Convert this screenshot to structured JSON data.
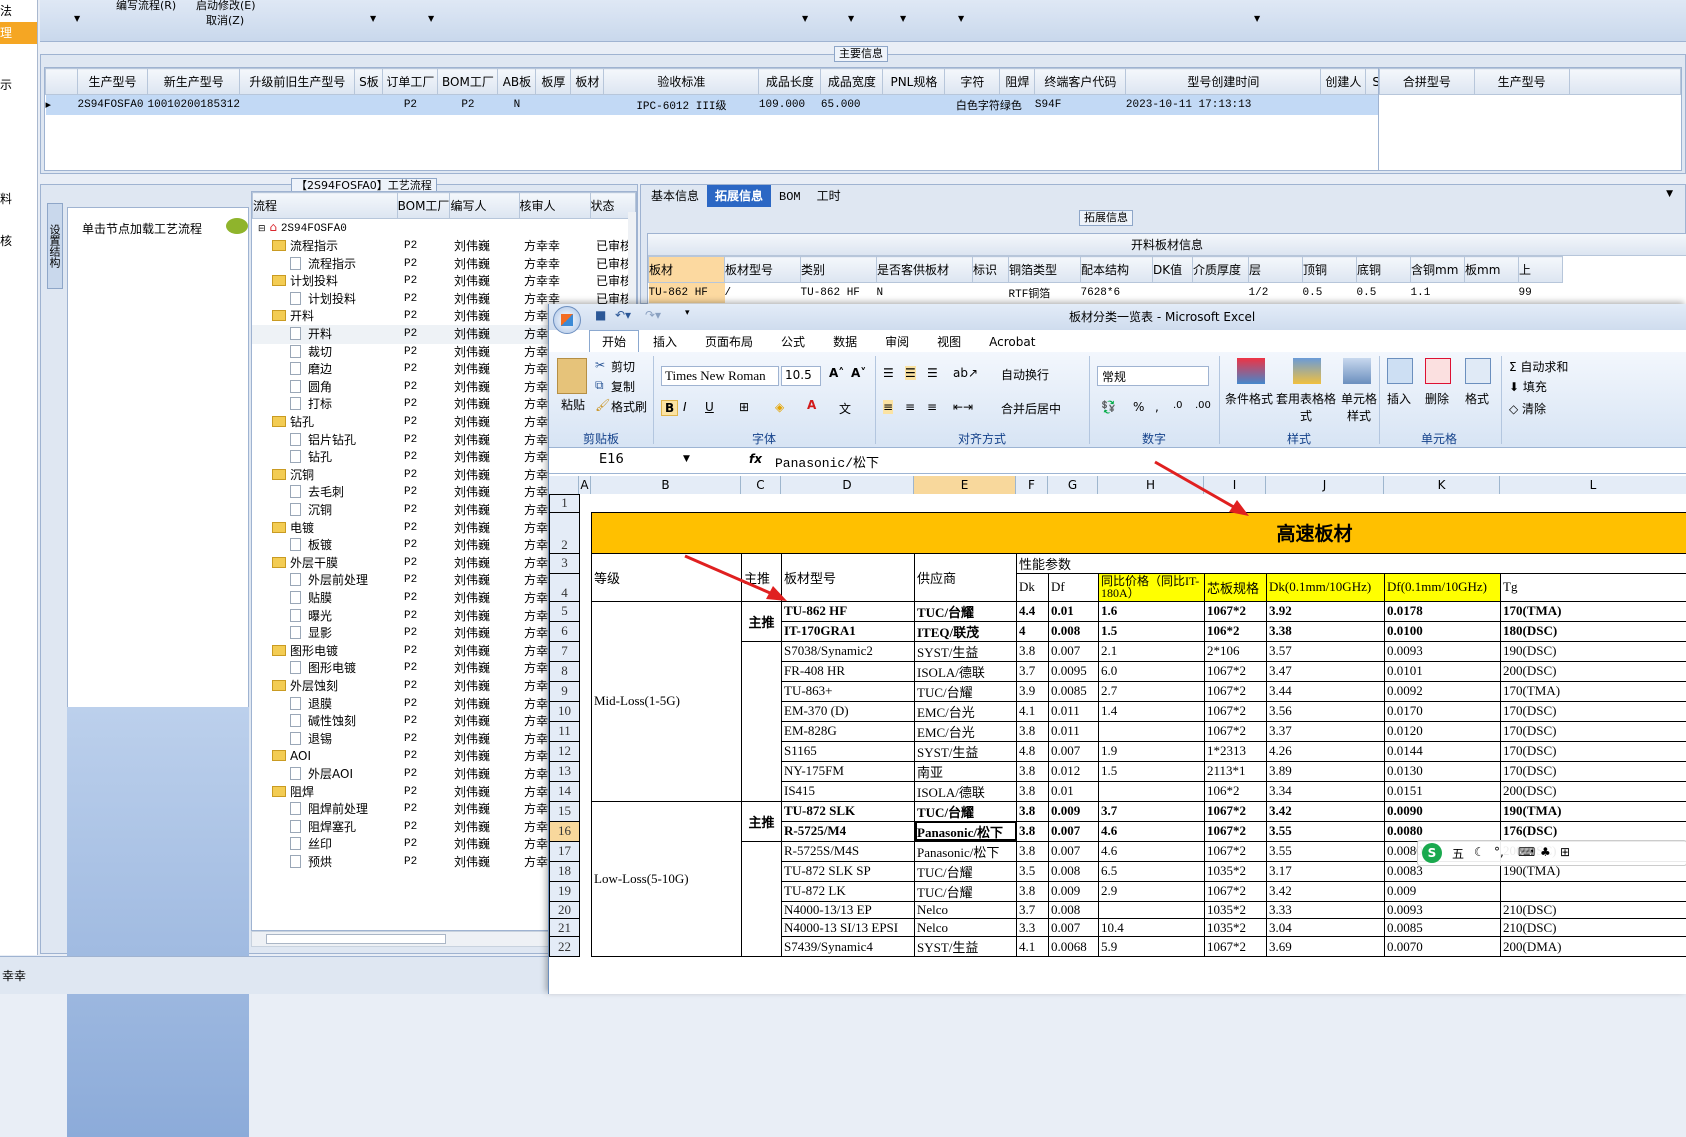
{
  "left_nav": [
    "法",
    "理",
    "示",
    "",
    "料",
    "核"
  ],
  "top_menu": {
    "edit_flow": "编写流程(R)",
    "start_modify": "启动修改(E)",
    "cancel": "取消(Z)"
  },
  "main_info": {
    "title": "主要信息",
    "columns": [
      "生产型号",
      "新生产型号",
      "升级前旧生产型号",
      "S板",
      "订单工厂",
      "BOM工厂",
      "AB板",
      "板厚",
      "板材",
      "验收标准",
      "成品长度",
      "成品宽度",
      "PNL规格",
      "字符",
      "阻焊",
      "终端客户代码",
      "型号创建时间",
      "创建人",
      "SO"
    ],
    "row": [
      "2S94FOSFA0",
      "10010200185312",
      "",
      "",
      "P2",
      "P2",
      "N",
      "",
      "",
      "IPC-6012 III级",
      "109.000",
      "65.000",
      "",
      "白色字符",
      "绿色",
      "S94F",
      "2023-10-11 17:13:13",
      "",
      ""
    ],
    "side_columns": [
      "合拼型号",
      "生产型号"
    ]
  },
  "process": {
    "title": "【2S94FOSFA0】工艺流程",
    "side_tab": "设置结构",
    "hint": "单击节点加载工艺流程",
    "columns": [
      "流程",
      "BOM工厂",
      "编写人",
      "核审人",
      "状态"
    ],
    "root": "2S94FOSFA0",
    "rows": [
      {
        "name": "流程指示",
        "type": "folder",
        "bom": "P2",
        "writer": "刘伟巍",
        "reviewer": "方幸幸",
        "status": "已审核"
      },
      {
        "name": "流程指示",
        "type": "doc",
        "bom": "P2",
        "writer": "刘伟巍",
        "reviewer": "方幸幸",
        "status": "已审核"
      },
      {
        "name": "计划投料",
        "type": "folder",
        "bom": "P2",
        "writer": "刘伟巍",
        "reviewer": "方幸幸",
        "status": "已审核"
      },
      {
        "name": "计划投料",
        "type": "doc",
        "bom": "P2",
        "writer": "刘伟巍",
        "reviewer": "方幸幸",
        "status": "已审核"
      },
      {
        "name": "开料",
        "type": "folder",
        "bom": "P2",
        "writer": "刘伟巍",
        "reviewer": "方幸幸",
        "status": ""
      },
      {
        "name": "开料",
        "type": "doc",
        "bom": "P2",
        "writer": "刘伟巍",
        "reviewer": "方幸",
        "status": ""
      },
      {
        "name": "裁切",
        "type": "doc",
        "bom": "P2",
        "writer": "刘伟巍",
        "reviewer": "方幸",
        "status": ""
      },
      {
        "name": "磨边",
        "type": "doc",
        "bom": "P2",
        "writer": "刘伟巍",
        "reviewer": "方幸",
        "status": ""
      },
      {
        "name": "圆角",
        "type": "doc",
        "bom": "P2",
        "writer": "刘伟巍",
        "reviewer": "方幸",
        "status": ""
      },
      {
        "name": "打标",
        "type": "doc",
        "bom": "P2",
        "writer": "刘伟巍",
        "reviewer": "方幸",
        "status": ""
      },
      {
        "name": "钻孔",
        "type": "folder",
        "bom": "P2",
        "writer": "刘伟巍",
        "reviewer": "方幸",
        "status": ""
      },
      {
        "name": "铝片钻孔",
        "type": "doc",
        "bom": "P2",
        "writer": "刘伟巍",
        "reviewer": "方幸",
        "status": ""
      },
      {
        "name": "钻孔",
        "type": "doc",
        "bom": "P2",
        "writer": "刘伟巍",
        "reviewer": "方幸",
        "status": ""
      },
      {
        "name": "沉铜",
        "type": "folder",
        "bom": "P2",
        "writer": "刘伟巍",
        "reviewer": "方幸",
        "status": ""
      },
      {
        "name": "去毛刺",
        "type": "doc",
        "bom": "P2",
        "writer": "刘伟巍",
        "reviewer": "方幸",
        "status": ""
      },
      {
        "name": "沉铜",
        "type": "doc",
        "bom": "P2",
        "writer": "刘伟巍",
        "reviewer": "方幸",
        "status": ""
      },
      {
        "name": "电镀",
        "type": "folder",
        "bom": "P2",
        "writer": "刘伟巍",
        "reviewer": "方幸",
        "status": ""
      },
      {
        "name": "板镀",
        "type": "doc",
        "bom": "P2",
        "writer": "刘伟巍",
        "reviewer": "方幸",
        "status": ""
      },
      {
        "name": "外层干膜",
        "type": "folder",
        "bom": "P2",
        "writer": "刘伟巍",
        "reviewer": "方幸",
        "status": ""
      },
      {
        "name": "外层前处理",
        "type": "doc",
        "bom": "P2",
        "writer": "刘伟巍",
        "reviewer": "方幸",
        "status": ""
      },
      {
        "name": "贴膜",
        "type": "doc",
        "bom": "P2",
        "writer": "刘伟巍",
        "reviewer": "方幸",
        "status": ""
      },
      {
        "name": "曝光",
        "type": "doc",
        "bom": "P2",
        "writer": "刘伟巍",
        "reviewer": "方幸",
        "status": ""
      },
      {
        "name": "显影",
        "type": "doc",
        "bom": "P2",
        "writer": "刘伟巍",
        "reviewer": "方幸",
        "status": ""
      },
      {
        "name": "图形电镀",
        "type": "folder",
        "bom": "P2",
        "writer": "刘伟巍",
        "reviewer": "方幸",
        "status": ""
      },
      {
        "name": "图形电镀",
        "type": "doc",
        "bom": "P2",
        "writer": "刘伟巍",
        "reviewer": "方幸",
        "status": ""
      },
      {
        "name": "外层蚀刻",
        "type": "folder",
        "bom": "P2",
        "writer": "刘伟巍",
        "reviewer": "方幸",
        "status": ""
      },
      {
        "name": "退膜",
        "type": "doc",
        "bom": "P2",
        "writer": "刘伟巍",
        "reviewer": "方幸",
        "status": ""
      },
      {
        "name": "碱性蚀刻",
        "type": "doc",
        "bom": "P2",
        "writer": "刘伟巍",
        "reviewer": "方幸",
        "status": ""
      },
      {
        "name": "退锡",
        "type": "doc",
        "bom": "P2",
        "writer": "刘伟巍",
        "reviewer": "方幸",
        "status": ""
      },
      {
        "name": "AOI",
        "type": "folder",
        "bom": "P2",
        "writer": "刘伟巍",
        "reviewer": "方幸",
        "status": ""
      },
      {
        "name": "外层AOI",
        "type": "doc",
        "bom": "P2",
        "writer": "刘伟巍",
        "reviewer": "方幸",
        "status": ""
      },
      {
        "name": "阻焊",
        "type": "folder",
        "bom": "P2",
        "writer": "刘伟巍",
        "reviewer": "方幸",
        "status": ""
      },
      {
        "name": "阻焊前处理",
        "type": "doc",
        "bom": "P2",
        "writer": "刘伟巍",
        "reviewer": "方幸",
        "status": ""
      },
      {
        "name": "阻焊塞孔",
        "type": "doc",
        "bom": "P2",
        "writer": "刘伟巍",
        "reviewer": "方幸",
        "status": ""
      },
      {
        "name": "丝印",
        "type": "doc",
        "bom": "P2",
        "writer": "刘伟巍",
        "reviewer": "方幸",
        "status": ""
      },
      {
        "name": "预烘",
        "type": "doc",
        "bom": "P2",
        "writer": "刘伟巍",
        "reviewer": "方幸",
        "status": ""
      }
    ]
  },
  "detail_tabs": [
    "基本信息",
    "拓展信息",
    "BOM",
    "工时"
  ],
  "ext_info": {
    "title": "拓展信息",
    "table_title": "开料板材信息",
    "columns": [
      "板材",
      "板材型号",
      "类别",
      "是否客供板材",
      "标识",
      "铜箔类型",
      "配本结构",
      "DK值",
      "介质厚度",
      "层",
      "顶铜",
      "底铜",
      "含铜mm",
      "板mm",
      "上"
    ],
    "row": [
      "TU-862 HF",
      "/",
      "TU-862 HF",
      "N",
      "",
      "RTF铜箔",
      "7628*6",
      "",
      "",
      "1/2",
      "0.5",
      "0.5",
      "1.1",
      "",
      "99"
    ]
  },
  "status_bar": "幸幸",
  "excel": {
    "title": "板材分类一览表 - Microsoft Excel",
    "tabs": [
      "开始",
      "插入",
      "页面布局",
      "公式",
      "数据",
      "审阅",
      "视图",
      "Acrobat"
    ],
    "clipboard": {
      "paste": "粘贴",
      "cut": "剪切",
      "copy": "复制",
      "format_painter": "格式刷",
      "group": "剪贴板"
    },
    "font": {
      "name": "Times New Roman",
      "size": "10.5",
      "group": "字体"
    },
    "align": {
      "wrap": "自动换行",
      "merge": "合并后居中",
      "group": "对齐方式"
    },
    "number": {
      "format": "常规",
      "group": "数字"
    },
    "styles": {
      "conditional": "条件格式",
      "table": "套用表格格式",
      "cell": "单元格样式",
      "group": "样式"
    },
    "cells": {
      "insert": "插入",
      "delete": "删除",
      "format": "格式",
      "group": "单元格"
    },
    "editing": {
      "autosum": "自动求和",
      "fill": "填充",
      "clear": "清除"
    },
    "name_box": "E16",
    "formula": "Panasonic/松下",
    "columns": [
      "A",
      "B",
      "C",
      "D",
      "E",
      "F",
      "G",
      "H",
      "I",
      "J",
      "K",
      "L"
    ],
    "banner": "高速板材",
    "perf_params": "性能参数",
    "headers": {
      "grade": "等级",
      "main": "主推",
      "model": "板材型号",
      "supplier": "供应商",
      "dk": "Dk",
      "df": "Df",
      "price": "同比价格（同比IT-180A）",
      "core": "芯板规格",
      "dk10": "Dk(0.1mm/10GHz)",
      "df10": "Df(0.1mm/10GHz)",
      "tg": "Tg"
    },
    "grade_mid": "Mid-Loss(1-5G)",
    "grade_low": "Low-Loss(5-10G)",
    "main_label": "主推",
    "rows": [
      {
        "r": "5",
        "model": "TU-862 HF",
        "sup": "TUC/台耀",
        "dk": "4.4",
        "df": "0.01",
        "price": "1.6",
        "core": "1067*2",
        "dk10": "3.92",
        "df10": "0.0178",
        "tg": "170(TMA)",
        "bold": true
      },
      {
        "r": "6",
        "model": "IT-170GRA1",
        "sup": "ITEQ/联茂",
        "dk": "4",
        "df": "0.008",
        "price": "1.5",
        "core": "106*2",
        "dk10": "3.38",
        "df10": "0.0100",
        "tg": "180(DSC)",
        "bold": true
      },
      {
        "r": "7",
        "model": "S7038/Synamic2",
        "sup": "SYST/生益",
        "dk": "3.8",
        "df": "0.007",
        "price": "2.1",
        "core": "2*106",
        "dk10": "3.57",
        "df10": "0.0093",
        "tg": "190(DSC)",
        "bold": false
      },
      {
        "r": "8",
        "model": "FR-408 HR",
        "sup": "ISOLA/德联",
        "dk": "3.7",
        "df": "0.0095",
        "price": "6.0",
        "core": "1067*2",
        "dk10": "3.47",
        "df10": "0.0101",
        "tg": "200(DSC)",
        "bold": false
      },
      {
        "r": "9",
        "model": "TU-863+",
        "sup": "TUC/台耀",
        "dk": "3.9",
        "df": "0.0085",
        "price": "2.7",
        "core": "1067*2",
        "dk10": "3.44",
        "df10": "0.0092",
        "tg": "170(TMA)",
        "bold": false
      },
      {
        "r": "10",
        "model": "EM-370 (D)",
        "sup": "EMC/台光",
        "dk": "4.1",
        "df": "0.011",
        "price": "1.4",
        "core": "1067*2",
        "dk10": "3.56",
        "df10": "0.0170",
        "tg": "170(DSC)",
        "bold": false
      },
      {
        "r": "11",
        "model": "EM-828G",
        "sup": "EMC/台光",
        "dk": "3.8",
        "df": "0.011",
        "price": "",
        "core": "1067*2",
        "dk10": "3.37",
        "df10": "0.0120",
        "tg": "170(DSC)",
        "bold": false
      },
      {
        "r": "12",
        "model": "S1165",
        "sup": "SYST/生益",
        "dk": "4.8",
        "df": "0.007",
        "price": "1.9",
        "core": "1*2313",
        "dk10": "4.26",
        "df10": "0.0144",
        "tg": "170(DSC)",
        "bold": false
      },
      {
        "r": "13",
        "model": "NY-175FM",
        "sup": "南亚",
        "dk": "3.8",
        "df": "0.012",
        "price": "1.5",
        "core": "2113*1",
        "dk10": "3.89",
        "df10": "0.0130",
        "tg": "170(DSC)",
        "bold": false
      },
      {
        "r": "14",
        "model": "IS415",
        "sup": "ISOLA/德联",
        "dk": "3.8",
        "df": "0.01",
        "price": "",
        "core": "106*2",
        "dk10": "3.34",
        "df10": "0.0151",
        "tg": "200(DSC)",
        "bold": false
      },
      {
        "r": "15",
        "model": "TU-872 SLK",
        "sup": "TUC/台耀",
        "dk": "3.8",
        "df": "0.009",
        "price": "3.7",
        "core": "1067*2",
        "dk10": "3.42",
        "df10": "0.0090",
        "tg": "190(TMA)",
        "bold": true
      },
      {
        "r": "16",
        "model": "R-5725/M4",
        "sup": "Panasonic/松下",
        "dk": "3.8",
        "df": "0.007",
        "price": "4.6",
        "core": "1067*2",
        "dk10": "3.55",
        "df10": "0.0080",
        "tg": "176(DSC)",
        "bold": true
      },
      {
        "r": "17",
        "model": "R-5725S/M4S",
        "sup": "Panasonic/松下",
        "dk": "3.8",
        "df": "0.007",
        "price": "4.6",
        "core": "1067*2",
        "dk10": "3.55",
        "df10": "0.0080",
        "tg": "200(DSC)",
        "bold": false
      },
      {
        "r": "18",
        "model": "TU-872 SLK SP",
        "sup": "TUC/台耀",
        "dk": "3.5",
        "df": "0.008",
        "price": "6.5",
        "core": "1035*2",
        "dk10": "3.17",
        "df10": "0.0083",
        "tg": "190(TMA)",
        "bold": false
      },
      {
        "r": "19",
        "model": "TU-872 LK",
        "sup": "TUC/台耀",
        "dk": "3.8",
        "df": "0.009",
        "price": "2.9",
        "core": "1067*2",
        "dk10": "3.42",
        "df10": "0.009",
        "tg": "",
        "bold": false
      },
      {
        "r": "20",
        "model": "N4000-13/13 EP",
        "sup": "Nelco",
        "dk": "3.7",
        "df": "0.008",
        "price": "",
        "core": "1035*2",
        "dk10": "3.33",
        "df10": "0.0093",
        "tg": "210(DSC)",
        "bold": false
      },
      {
        "r": "21",
        "model": "N4000-13 SI/13 EPSI",
        "sup": "Nelco",
        "dk": "3.3",
        "df": "0.007",
        "price": "10.4",
        "core": "1035*2",
        "dk10": "3.04",
        "df10": "0.0085",
        "tg": "210(DSC)",
        "bold": false
      },
      {
        "r": "22",
        "model": "S7439/Synamic4",
        "sup": "SYST/生益",
        "dk": "4.1",
        "df": "0.0068",
        "price": "5.9",
        "core": "1067*2",
        "dk10": "3.69",
        "df10": "0.0070",
        "tg": "200(DMA)",
        "bold": false
      }
    ],
    "ime_label": "五"
  },
  "colors": {
    "accent": "#ffc000",
    "selection": "#c2d9f5",
    "arrow": "#e02020",
    "yellow": "#ffff00"
  }
}
